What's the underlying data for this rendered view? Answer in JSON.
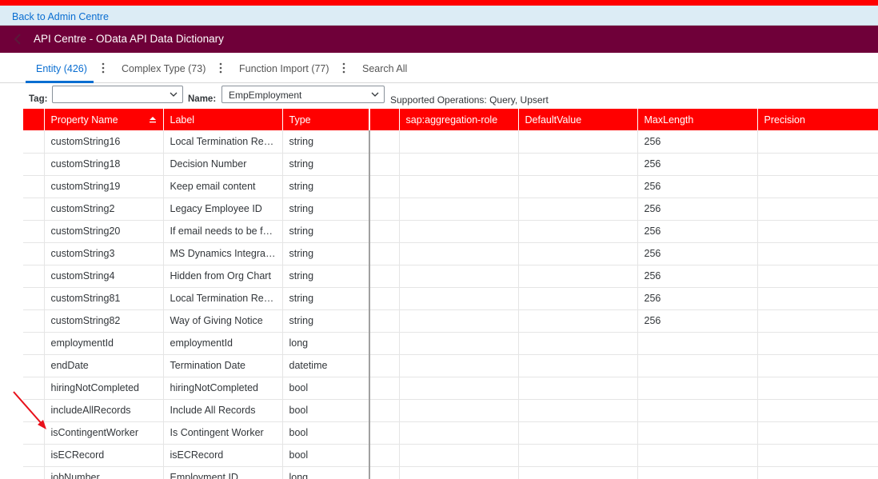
{
  "header": {
    "back_link": "Back to Admin Centre",
    "title": "API Centre - OData API Data Dictionary"
  },
  "tabs": [
    {
      "label": "Entity (426)",
      "active": true
    },
    {
      "label": "Complex Type (73)",
      "active": false
    },
    {
      "label": "Function Import (77)",
      "active": false
    },
    {
      "label": "Search All",
      "active": false
    }
  ],
  "filters": {
    "tag_label": "Tag:",
    "tag_value": "",
    "name_label": "Name:",
    "name_value": "EmpEmployment",
    "supported_ops": "Supported Operations: Query, Upsert"
  },
  "table": {
    "columns": [
      "",
      "Property Name",
      "Label",
      "Type",
      "",
      "sap:aggregation-role",
      "DefaultValue",
      "MaxLength",
      "Precision"
    ],
    "rows": [
      [
        "",
        "customString16",
        "Local Termination Reason",
        "string",
        "",
        "",
        "",
        "256",
        ""
      ],
      [
        "",
        "customString18",
        "Decision Number",
        "string",
        "",
        "",
        "",
        "256",
        ""
      ],
      [
        "",
        "customString19",
        "Keep email content",
        "string",
        "",
        "",
        "",
        "256",
        ""
      ],
      [
        "",
        "customString2",
        "Legacy Employee ID",
        "string",
        "",
        "",
        "",
        "256",
        ""
      ],
      [
        "",
        "customString20",
        "If email needs to be for...",
        "string",
        "",
        "",
        "",
        "256",
        ""
      ],
      [
        "",
        "customString3",
        "MS Dynamics Integratio...",
        "string",
        "",
        "",
        "",
        "256",
        ""
      ],
      [
        "",
        "customString4",
        "Hidden from Org Chart",
        "string",
        "",
        "",
        "",
        "256",
        ""
      ],
      [
        "",
        "customString81",
        "Local Termination Reason",
        "string",
        "",
        "",
        "",
        "256",
        ""
      ],
      [
        "",
        "customString82",
        "Way of Giving Notice",
        "string",
        "",
        "",
        "",
        "256",
        ""
      ],
      [
        "",
        "employmentId",
        "employmentId",
        "long",
        "",
        "",
        "",
        "",
        ""
      ],
      [
        "",
        "endDate",
        "Termination Date",
        "datetime",
        "",
        "",
        "",
        "",
        ""
      ],
      [
        "",
        "hiringNotCompleted",
        "hiringNotCompleted",
        "bool",
        "",
        "",
        "",
        "",
        ""
      ],
      [
        "",
        "includeAllRecords",
        "Include All Records",
        "bool",
        "",
        "",
        "",
        "",
        ""
      ],
      [
        "",
        "isContingentWorker",
        "Is Contingent Worker",
        "bool",
        "",
        "",
        "",
        "",
        ""
      ],
      [
        "",
        "isECRecord",
        "isECRecord",
        "bool",
        "",
        "",
        "",
        "",
        ""
      ],
      [
        "",
        "jobNumber",
        "Employment ID",
        "long",
        "",
        "",
        "",
        "",
        ""
      ]
    ]
  },
  "colors": {
    "top_bar": "#ff0000",
    "title_bar": "#6f0039",
    "header_row": "#ff0000",
    "accent": "#0a6ed1",
    "annotation_arrow": "#e8101a"
  },
  "icons": {
    "back": "chevron-left-icon",
    "sort": "sort-ascending-icon",
    "dropdown": "chevron-down-icon",
    "overflow": "vertical-ellipsis-icon",
    "annotation": "red-arrow-annotation"
  }
}
